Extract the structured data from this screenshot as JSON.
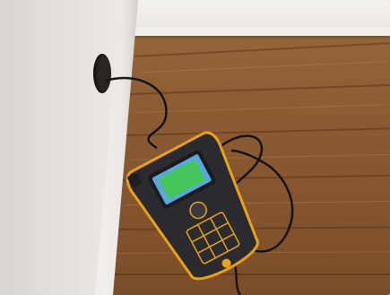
{
  "scene": {
    "description_icons": [
      "moisture-meter",
      "probe-cable",
      "wall-hole"
    ],
    "colors": {
      "meter_body": "#2b2b2f",
      "meter_trim": "#e7a21a",
      "screen_green": "#43c65a",
      "screen_blue": "#58a7e0",
      "floor": "#8d5c33",
      "wall": "#e6e3df"
    }
  }
}
